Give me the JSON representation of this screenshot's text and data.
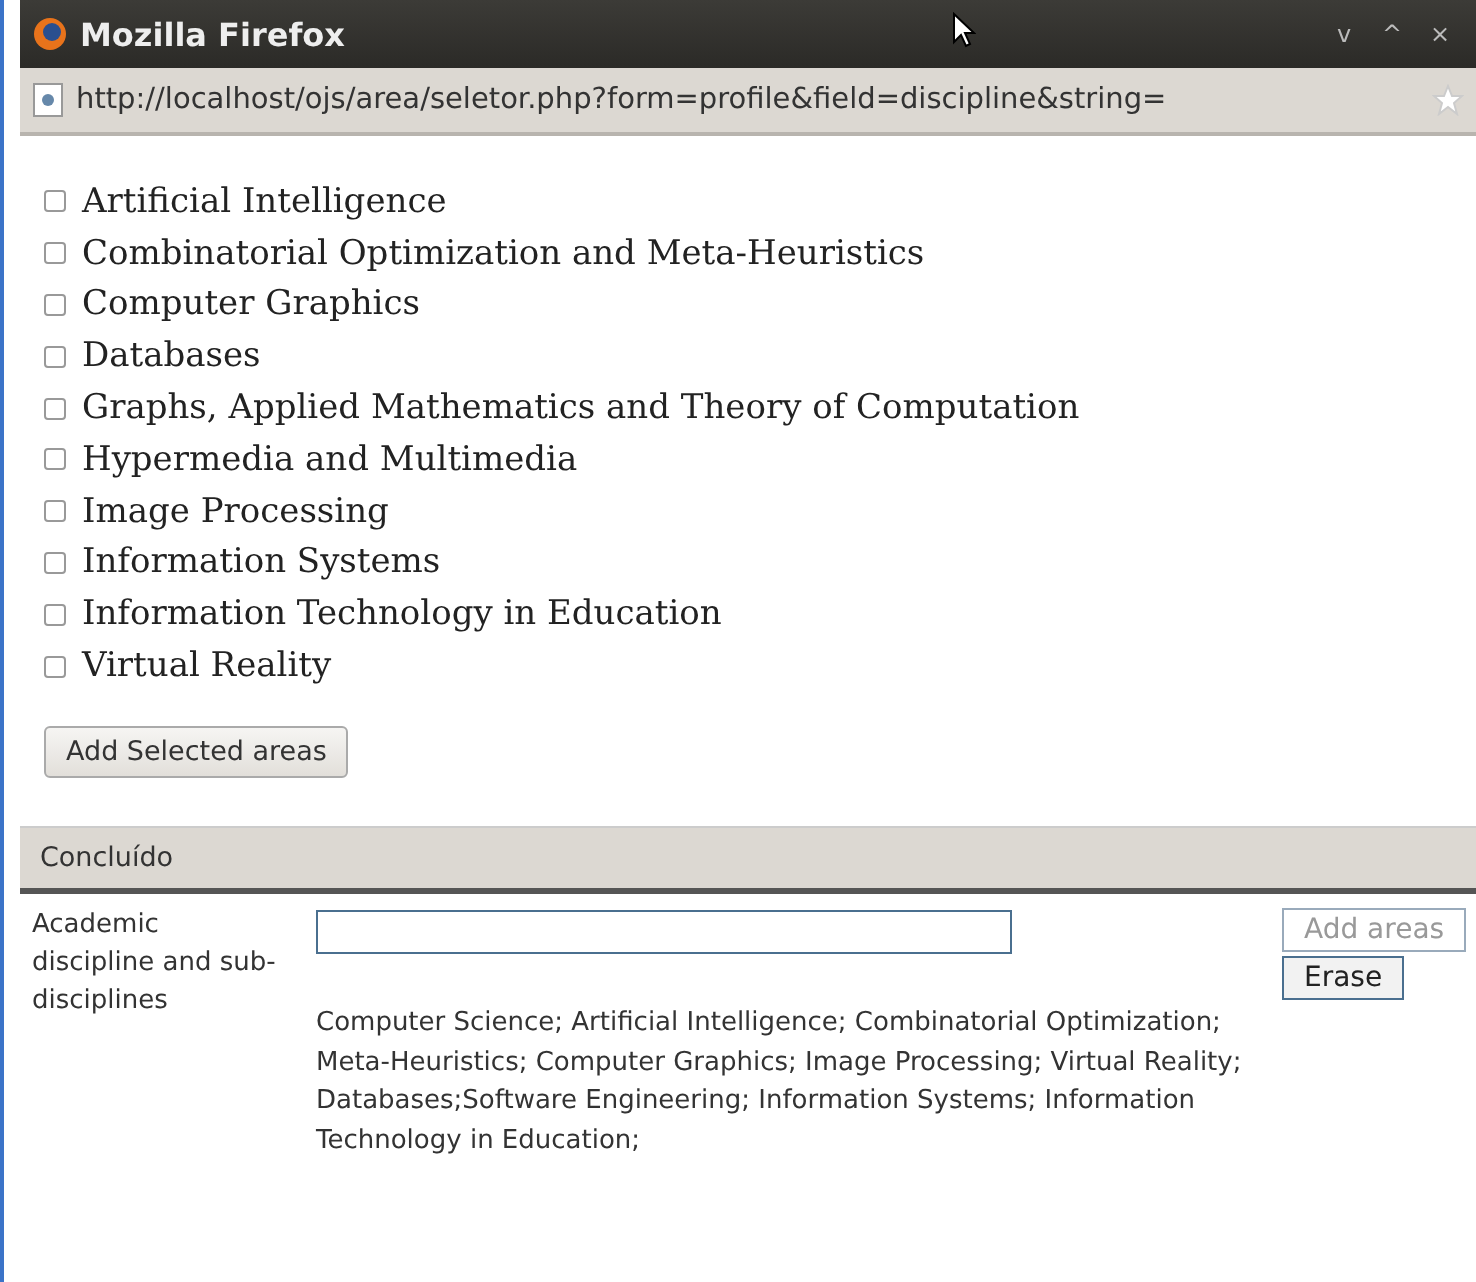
{
  "window": {
    "title": "Mozilla Firefox",
    "controls": [
      "v",
      "^",
      "×"
    ],
    "url": "http://localhost/ojs/area/seletor.php?form=profile&field=discipline&string="
  },
  "areas": [
    {
      "label": "Artificial Intelligence",
      "checked": false
    },
    {
      "label": "Combinatorial Optimization and Meta-Heuristics",
      "checked": false
    },
    {
      "label": "Computer Graphics",
      "checked": false
    },
    {
      "label": "Databases",
      "checked": false
    },
    {
      "label": "Graphs, Applied Mathematics and Theory of Computation",
      "checked": false
    },
    {
      "label": "Hypermedia and Multimedia",
      "checked": false
    },
    {
      "label": "Image Processing",
      "checked": false
    },
    {
      "label": "Information Systems",
      "checked": false
    },
    {
      "label": "Information Technology in Education",
      "checked": false
    },
    {
      "label": "Virtual Reality",
      "checked": false
    }
  ],
  "add_button": "Add Selected areas",
  "status_bar": "Concluído",
  "form": {
    "label": "Academic discipline and sub-disciplines",
    "add_areas": {
      "label": "Add areas",
      "disabled": true
    },
    "erase": "Erase",
    "selected_text": "Computer Science; Artificial Intelligence; Combinatorial Optimization; Meta-Heuristics; Computer Graphics; Image Processing; Virtual Reality; Databases;Software Engineering; Information Systems; Information Technology in Education;"
  }
}
